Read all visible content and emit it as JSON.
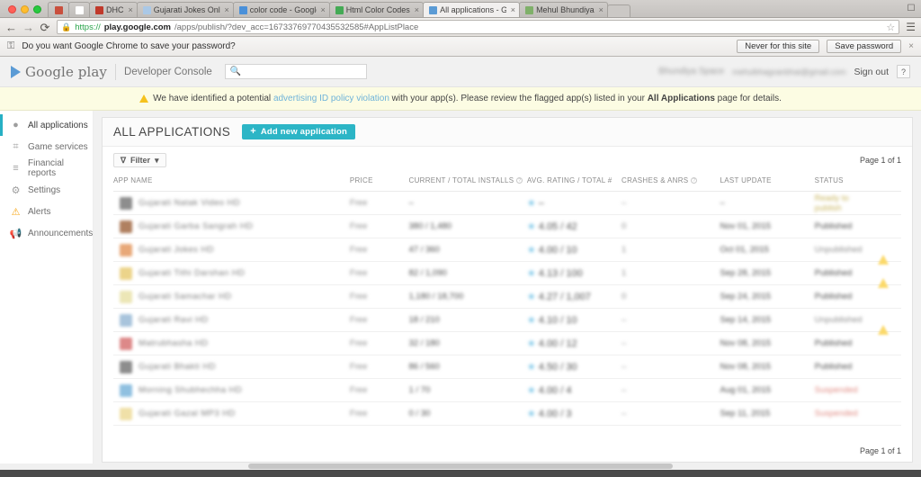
{
  "browser": {
    "tabs": [
      {
        "title": "",
        "favicon": "#c94f3d",
        "mini": true,
        "active": false,
        "close": ""
      },
      {
        "title": "",
        "favicon": "#ffffff",
        "mini": true,
        "active": false,
        "close": ""
      },
      {
        "title": "DHC",
        "favicon": "#c0392b",
        "active": false,
        "close": "×"
      },
      {
        "title": "Gujarati Jokes Online",
        "favicon": "#aac8e6",
        "active": false,
        "close": "×"
      },
      {
        "title": "color code - Google Searc",
        "favicon": "#4a90d9",
        "active": false,
        "close": "×"
      },
      {
        "title": "Html Color Codes",
        "favicon": "#44aa55",
        "active": false,
        "close": "×"
      },
      {
        "title": "All applications - Google P",
        "favicon": "#5b9bd5",
        "active": true,
        "close": "×"
      },
      {
        "title": "Mehul Bhundiya",
        "favicon": "#7fb069",
        "active": false,
        "close": "×"
      }
    ],
    "nav": {
      "back": "←",
      "forward": "→",
      "reload": "⟳"
    },
    "omnibox": {
      "lock": "🔒",
      "scheme": "https://",
      "host": "play.google.com",
      "path": "/apps/publish/?dev_acc=16733769770435532585#AppListPlace",
      "star": "☆",
      "menu": "☰"
    },
    "infobar": {
      "key_icon": "🗝",
      "message": "Do you want Google Chrome to save your password?",
      "never_label": "Never for this site",
      "save_label": "Save password",
      "close": "×"
    }
  },
  "header": {
    "wordmark": "Google play",
    "console": "Developer Console",
    "search_placeholder": "",
    "search_icon": "🔍",
    "account_name": "Bhundiya Space",
    "account_email": "mehulbhagvanbhai@gmail.com",
    "signout": "Sign out",
    "help": "?"
  },
  "notice": {
    "text_before": "We have identified a potential ",
    "link": "advertising ID policy violation",
    "text_mid": " with your app(s). Please review the flagged app(s) listed in your ",
    "bold": "All Applications",
    "text_after": " page for details."
  },
  "sidebar": {
    "items": [
      {
        "label": "All applications",
        "icon": "android-icon",
        "glyph": "●",
        "active": true
      },
      {
        "label": "Game services",
        "icon": "gamepad-icon",
        "glyph": "⌗",
        "active": false
      },
      {
        "label": "Financial reports",
        "icon": "reports-icon",
        "glyph": "≡",
        "active": false
      },
      {
        "label": "Settings",
        "icon": "gear-icon",
        "glyph": "⚙",
        "active": false
      },
      {
        "label": "Alerts",
        "icon": "alert-icon",
        "glyph": "⚠",
        "active": false
      },
      {
        "label": "Announcements",
        "icon": "megaphone-icon",
        "glyph": "📢",
        "active": false
      }
    ]
  },
  "main": {
    "title": "ALL APPLICATIONS",
    "add_button": "Add new application",
    "add_plus": "+",
    "filter_label": "Filter",
    "filter_icon": "∇",
    "filter_caret": "▾",
    "page_info_top": "Page 1 of 1",
    "page_info_bottom": "Page 1 of 1",
    "columns": [
      {
        "label": "APP NAME",
        "help": false
      },
      {
        "label": "PRICE",
        "help": false
      },
      {
        "label": "CURRENT / TOTAL INSTALLS",
        "help": true
      },
      {
        "label": "AVG. RATING / TOTAL #",
        "help": false
      },
      {
        "label": "CRASHES & ANRS",
        "help": true
      },
      {
        "label": "LAST UPDATE",
        "help": false
      },
      {
        "label": "STATUS",
        "help": false
      },
      {
        "label": "",
        "help": false
      }
    ],
    "rows": [
      {
        "icon_color": "#8d8d8d",
        "name": "Gujarati Natak Video HD",
        "price": "Free",
        "installs": "–",
        "rating": "–",
        "crashes": "–",
        "updated": "–",
        "status": "Ready to publish",
        "status_kind": "amber",
        "warn": false
      },
      {
        "icon_color": "#b08060",
        "name": "Gujarati Garba Sangrah HD",
        "price": "Free",
        "installs": "380 / 1,480",
        "rating": "4.05 / 42",
        "crashes": "0",
        "updated": "Nov 01, 2015",
        "status": "Published",
        "status_kind": "dark",
        "warn": false
      },
      {
        "icon_color": "#e8a878",
        "name": "Gujarati Jokes HD",
        "price": "Free",
        "installs": "47 / 360",
        "rating": "4.00 / 10",
        "crashes": "1",
        "updated": "Oct 01, 2015",
        "status": "Unpublished",
        "status_kind": "gray",
        "warn": true
      },
      {
        "icon_color": "#ecd48a",
        "name": "Gujarati Tithi Darshan HD",
        "price": "Free",
        "installs": "82 / 1,090",
        "rating": "4.13 / 100",
        "crashes": "1",
        "updated": "Sep 28, 2015",
        "status": "Published",
        "status_kind": "dark",
        "warn": true
      },
      {
        "icon_color": "#ece6b6",
        "name": "Gujarati Samachar HD",
        "price": "Free",
        "installs": "1,180 / 18,700",
        "rating": "4.27 / 1,007",
        "crashes": "0",
        "updated": "Sep 24, 2015",
        "status": "Published",
        "status_kind": "dark",
        "warn": false
      },
      {
        "icon_color": "#a8c4dc",
        "name": "Gujarati Ravi HD",
        "price": "Free",
        "installs": "18 / 210",
        "rating": "4.10 / 10",
        "crashes": "–",
        "updated": "Sep 14, 2015",
        "status": "Unpublished",
        "status_kind": "gray",
        "warn": true
      },
      {
        "icon_color": "#dd8888",
        "name": "Matrubhasha HD",
        "price": "Free",
        "installs": "32 / 180",
        "rating": "4.00 / 12",
        "crashes": "–",
        "updated": "Nov 08, 2015",
        "status": "Published",
        "status_kind": "dark",
        "warn": false
      },
      {
        "icon_color": "#8d8d8d",
        "name": "Gujarati Bhakti HD",
        "price": "Free",
        "installs": "86 / 560",
        "rating": "4.50 / 30",
        "crashes": "–",
        "updated": "Nov 08, 2015",
        "status": "Published",
        "status_kind": "dark",
        "warn": false
      },
      {
        "icon_color": "#8fc0e0",
        "name": "Morning Shubhechha HD",
        "price": "Free",
        "installs": "1 / 70",
        "rating": "4.00 / 4",
        "crashes": "–",
        "updated": "Aug 01, 2015",
        "status": "Suspended",
        "status_kind": "red",
        "warn": false
      },
      {
        "icon_color": "#f0e0a8",
        "name": "Gujarati Gazal MP3 HD",
        "price": "Free",
        "installs": "0 / 30",
        "rating": "4.00 / 3",
        "crashes": "–",
        "updated": "Sep 11, 2015",
        "status": "Suspended",
        "status_kind": "red",
        "warn": false
      }
    ]
  }
}
